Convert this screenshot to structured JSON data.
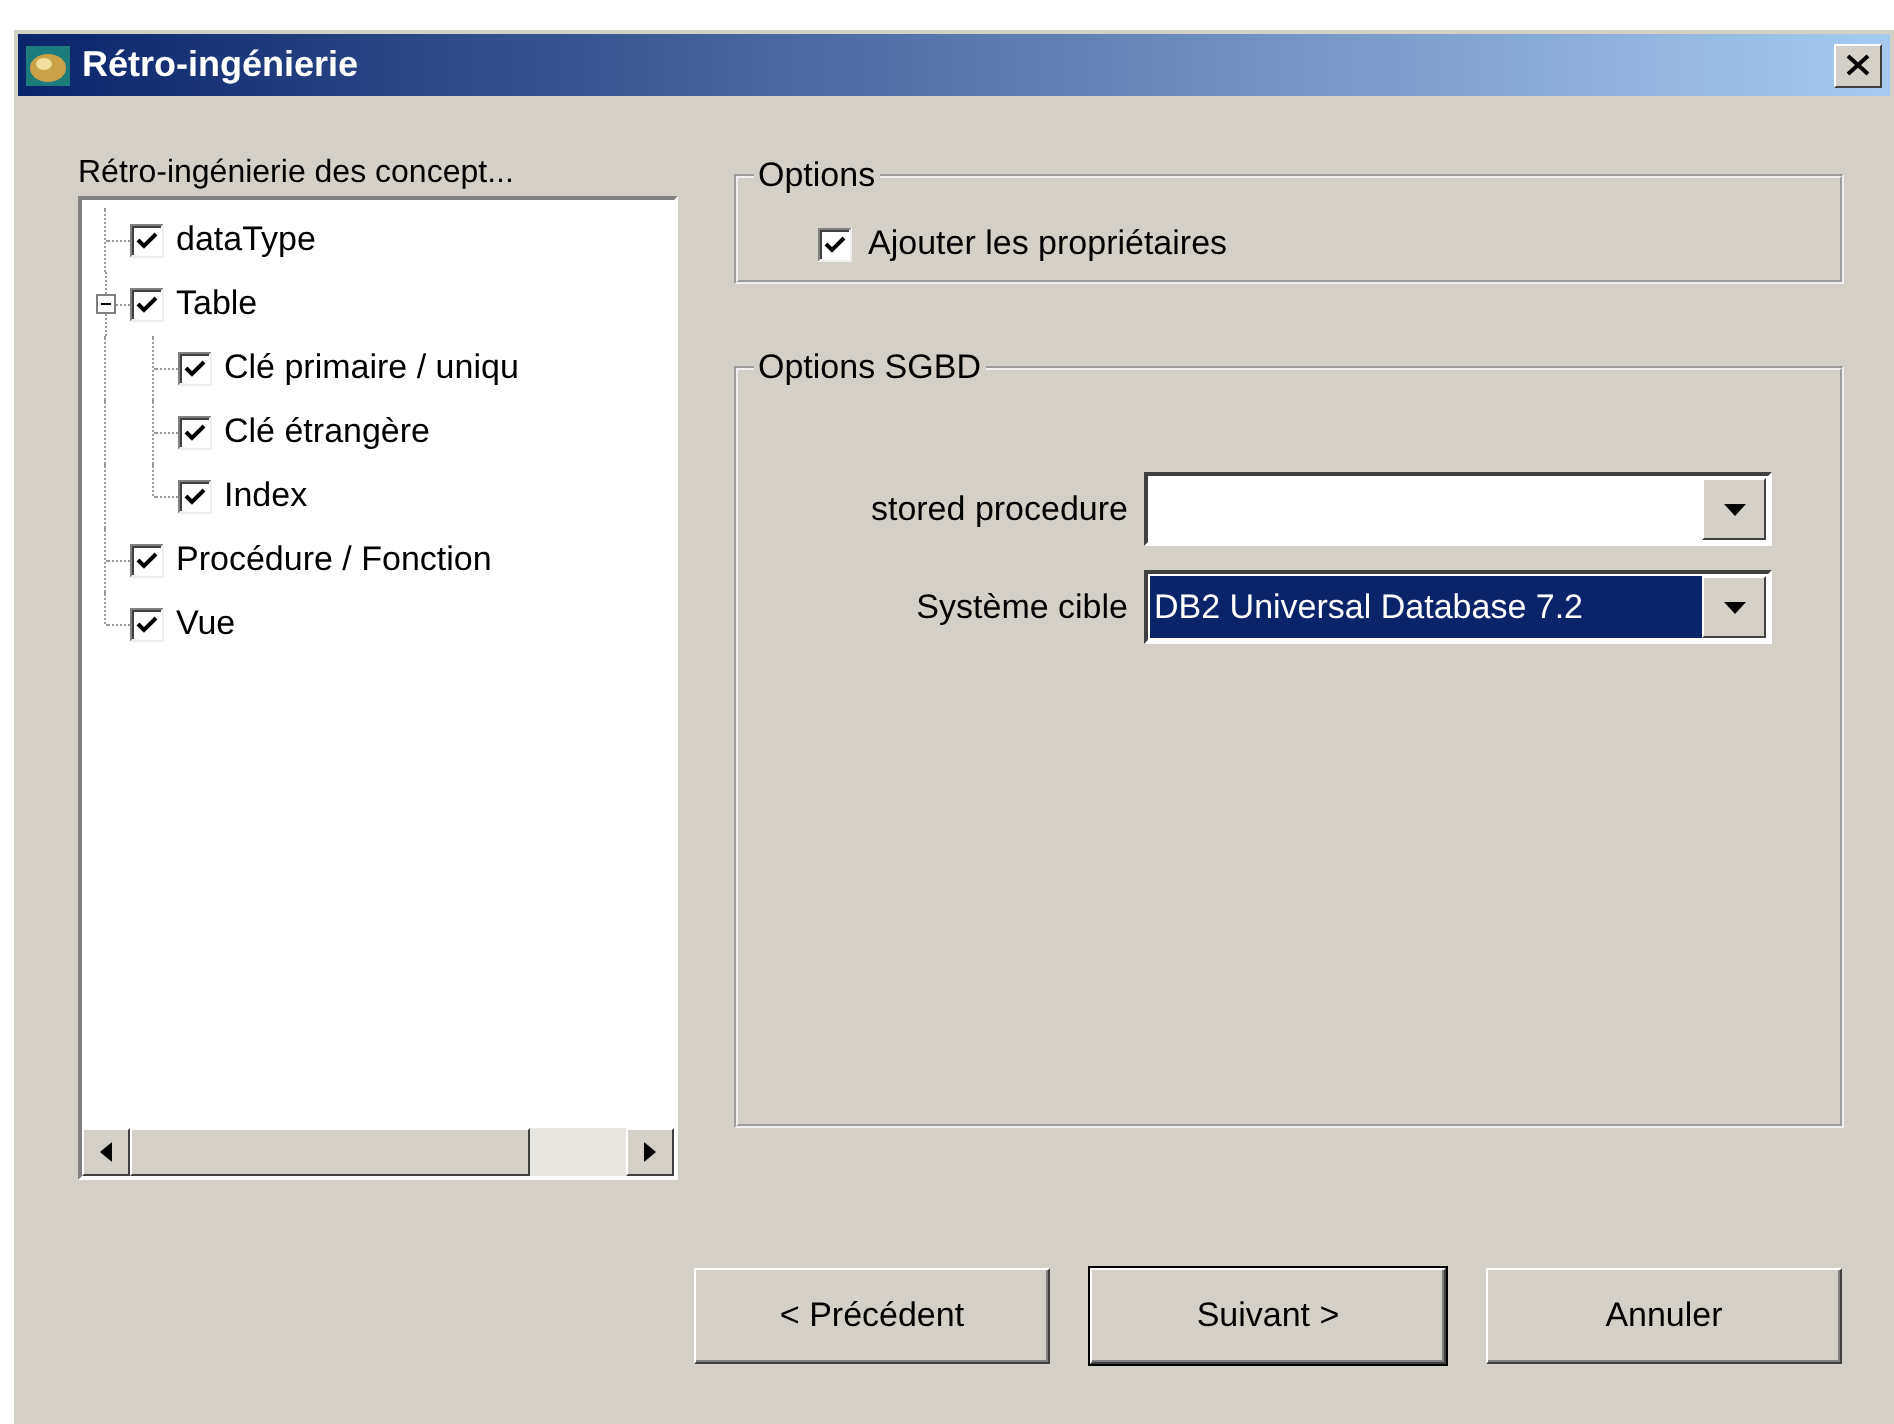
{
  "window": {
    "title": "Rétro-ingénierie"
  },
  "tree": {
    "label": "Rétro-ingénierie des concept...",
    "items": [
      {
        "label": "dataType",
        "checked": true
      },
      {
        "label": "Table",
        "checked": true,
        "expanded": true,
        "children": [
          {
            "label": "Clé primaire / uniqu",
            "checked": true
          },
          {
            "label": "Clé étrangère",
            "checked": true
          },
          {
            "label": "Index",
            "checked": true
          }
        ]
      },
      {
        "label": "Procédure / Fonction",
        "checked": true
      },
      {
        "label": "Vue",
        "checked": true
      }
    ]
  },
  "options": {
    "title": "Options",
    "checkbox": {
      "label": "Ajouter les propriétaires",
      "checked": true
    }
  },
  "dbms_options": {
    "title": "Options SGBD",
    "fields": [
      {
        "label": "stored procedure",
        "selected": false
      },
      {
        "label": "Système cible",
        "value": "DB2 Universal Database 7.2",
        "selected": true
      }
    ]
  },
  "buttons": [
    {
      "label": "< Précédent",
      "default": false
    },
    {
      "label": "Suivant >",
      "default": true
    },
    {
      "label": "Annuler",
      "default": false
    }
  ]
}
